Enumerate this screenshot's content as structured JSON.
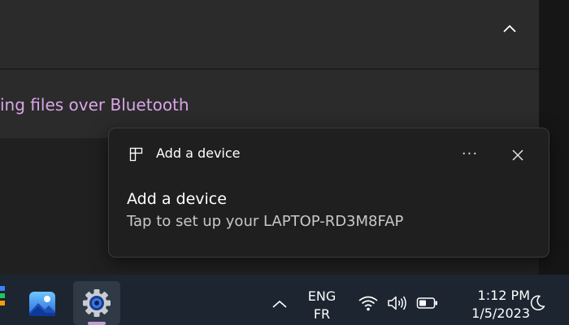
{
  "settings": {
    "bluetooth_link": "ing files over Bluetooth"
  },
  "toast": {
    "app_name": "Add a device",
    "more_glyph": "···",
    "title": "Add a device",
    "body": "Tap to set up your LAPTOP-RD3M8FAP"
  },
  "taskbar": {
    "input_lang_primary": "ENG",
    "input_lang_secondary": "FR",
    "time": "1:12 PM",
    "date": "1/5/2023",
    "accent_color": "#c29ad8"
  },
  "icons": {
    "toast_app": "add-device-icon",
    "toast_more": "more-options-icon",
    "toast_close": "close-icon",
    "settings_chevron": "chevron-up-icon",
    "taskbar_overflow": "chevron-up-icon",
    "wifi": "wifi-icon",
    "volume": "volume-icon",
    "battery": "battery-icon",
    "focus": "moon-icon",
    "photos": "photos-app-icon",
    "settings": "settings-gear-icon"
  }
}
